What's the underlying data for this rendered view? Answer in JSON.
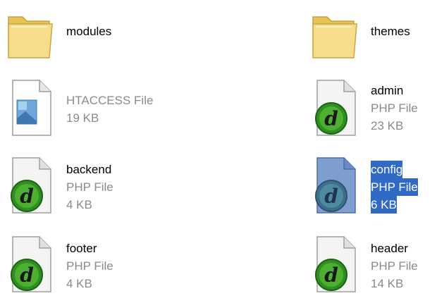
{
  "window": {
    "title": ""
  },
  "files": [
    {
      "name": "modules",
      "type": "",
      "size": "",
      "icon": "folder-icon"
    },
    {
      "name": "themes",
      "type": "",
      "size": "",
      "icon": "folder-icon"
    },
    {
      "name": "",
      "type": "HTACCESS File",
      "size": "19 KB",
      "icon": "generic-file-icon"
    },
    {
      "name": "admin",
      "type": "PHP File",
      "size": "23 KB",
      "icon": "dreamweaver-php-icon"
    },
    {
      "name": "backend",
      "type": "PHP File",
      "size": "4 KB",
      "icon": "dreamweaver-php-icon"
    },
    {
      "name": "config",
      "type": "PHP File",
      "size": "6 KB",
      "icon": "dreamweaver-php-icon",
      "selected": true
    },
    {
      "name": "footer",
      "type": "PHP File",
      "size": "4 KB",
      "icon": "dreamweaver-php-icon"
    },
    {
      "name": "header",
      "type": "PHP File",
      "size": "14 KB",
      "icon": "dreamweaver-php-icon"
    }
  ],
  "colors": {
    "selection": "#316ac5",
    "folder": "#f5d97a",
    "dreamweaver": "#2f8f1f",
    "subtext": "#8a8a8a"
  }
}
